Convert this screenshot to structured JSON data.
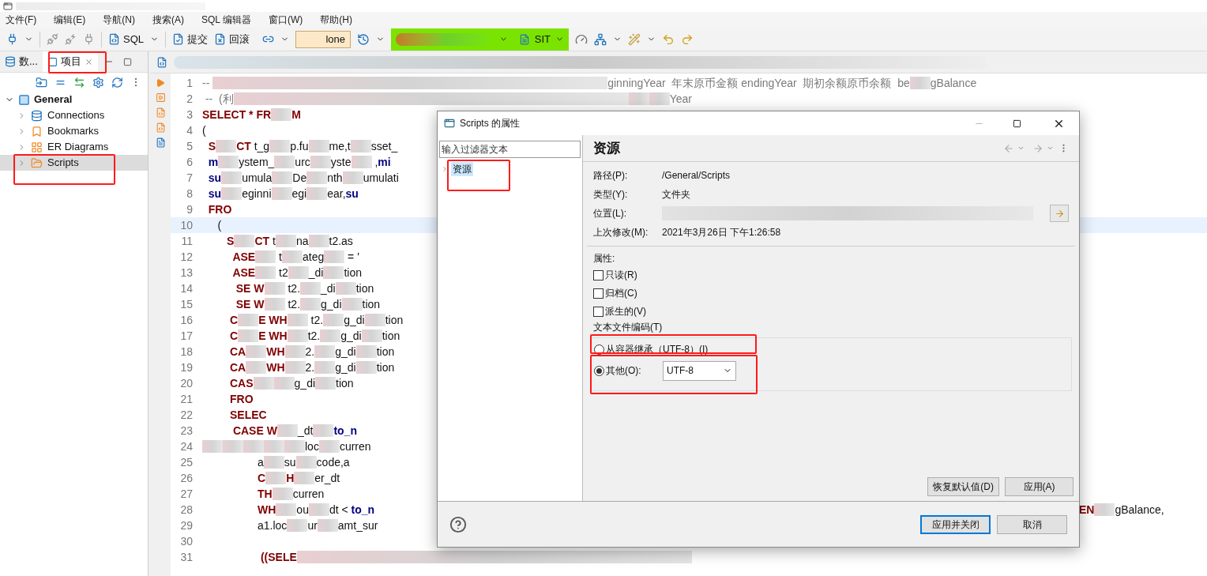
{
  "menu": [
    {
      "label": "文件(F)"
    },
    {
      "label": "编辑(E)"
    },
    {
      "label": "导航(N)"
    },
    {
      "label": "搜索(A)"
    },
    {
      "label": "SQL 编辑器"
    },
    {
      "label": "窗口(W)"
    },
    {
      "label": "帮助(H)"
    }
  ],
  "toolbar": {
    "sql": "SQL",
    "commit": "提交",
    "rollback": "回滚",
    "transaction": "lone",
    "environment": "SIT"
  },
  "left_panel": {
    "tabs": [
      {
        "label": "数...",
        "selected": false
      },
      {
        "label": "项目",
        "selected": true
      }
    ],
    "tree": {
      "label": "General",
      "expanded": true,
      "children": [
        {
          "label": "Connections",
          "kind": "connections",
          "expanded": false,
          "selected": false
        },
        {
          "label": "Bookmarks",
          "kind": "bookmarks",
          "expanded": false,
          "selected": false
        },
        {
          "label": "ER Diagrams",
          "kind": "diagrams",
          "expanded": false,
          "selected": false
        },
        {
          "label": "Scripts",
          "kind": "scripts",
          "expanded": false,
          "selected": true
        }
      ]
    }
  },
  "editor": {
    "lines": [
      {
        "number": "1",
        "current": false,
        "segments": [
          {
            "kind": "comment",
            "text": "-- "
          },
          {
            "kind": "wide_blur"
          },
          {
            "kind": "comment",
            "text": "ginningYear  年末原币金额 endingYear  期初余额原币余额  be"
          },
          {
            "kind": "blur"
          },
          {
            "kind": "comment",
            "text": "gBalance"
          }
        ]
      },
      {
        "number": "2",
        "current": false,
        "segments": [
          {
            "kind": "comment",
            "text": " --  (利"
          },
          {
            "kind": "wide_blur"
          },
          {
            "kind": "blur"
          },
          {
            "kind": "blur"
          },
          {
            "kind": "comment",
            "text": "Year"
          }
        ]
      },
      {
        "number": "3",
        "current": false,
        "segments": [
          {
            "kind": "kw",
            "text": "SELECT * FR"
          },
          {
            "kind": "blur"
          },
          {
            "kind": "kw",
            "text": "M"
          }
        ]
      },
      {
        "number": "4",
        "current": false,
        "segments": [
          {
            "kind": "plain",
            "text": "("
          }
        ]
      },
      {
        "number": "5",
        "current": false,
        "segments": [
          {
            "kind": "kw",
            "text": "  S"
          },
          {
            "kind": "blur"
          },
          {
            "kind": "kw",
            "text": "CT"
          },
          {
            "kind": "plain",
            "text": " t_g"
          },
          {
            "kind": "blur"
          },
          {
            "kind": "plain",
            "text": "p.fu"
          },
          {
            "kind": "blur"
          },
          {
            "kind": "plain",
            "text": "me,t"
          },
          {
            "kind": "blur"
          },
          {
            "kind": "plain",
            "text": "sset_"
          }
        ]
      },
      {
        "number": "6",
        "current": false,
        "segments": [
          {
            "kind": "fn",
            "text": "  m"
          },
          {
            "kind": "blur"
          },
          {
            "kind": "plain",
            "text": "ystem_"
          },
          {
            "kind": "blur"
          },
          {
            "kind": "plain",
            "text": "urc"
          },
          {
            "kind": "blur"
          },
          {
            "kind": "plain",
            "text": "yste"
          },
          {
            "kind": "blur"
          },
          {
            "kind": "plain",
            "text": " ,"
          },
          {
            "kind": "fn",
            "text": "mi"
          }
        ]
      },
      {
        "number": "7",
        "current": false,
        "segments": [
          {
            "kind": "fn",
            "text": "  su"
          },
          {
            "kind": "blur"
          },
          {
            "kind": "plain",
            "text": "umula"
          },
          {
            "kind": "blur"
          },
          {
            "kind": "plain",
            "text": "De"
          },
          {
            "kind": "blur"
          },
          {
            "kind": "plain",
            "text": "nth"
          },
          {
            "kind": "blur"
          },
          {
            "kind": "plain",
            "text": "umulati"
          }
        ]
      },
      {
        "number": "8",
        "current": false,
        "segments": [
          {
            "kind": "fn",
            "text": "  su"
          },
          {
            "kind": "blur"
          },
          {
            "kind": "plain",
            "text": "eginni"
          },
          {
            "kind": "blur"
          },
          {
            "kind": "plain",
            "text": "egi"
          },
          {
            "kind": "blur"
          },
          {
            "kind": "plain",
            "text": "ear,"
          },
          {
            "kind": "fn",
            "text": "su"
          }
        ]
      },
      {
        "number": "9",
        "current": false,
        "segments": [
          {
            "kind": "kw",
            "text": "  FRO"
          }
        ]
      },
      {
        "number": "10",
        "current": true,
        "segments": [
          {
            "kind": "plain",
            "text": "     ("
          }
        ]
      },
      {
        "number": "11",
        "current": false,
        "segments": [
          {
            "kind": "kw",
            "text": "        S"
          },
          {
            "kind": "blur"
          },
          {
            "kind": "kw",
            "text": "CT"
          },
          {
            "kind": "plain",
            "text": " t"
          },
          {
            "kind": "blur"
          },
          {
            "kind": "plain",
            "text": "na"
          },
          {
            "kind": "blur"
          },
          {
            "kind": "plain",
            "text": "t2.as"
          }
        ]
      },
      {
        "number": "12",
        "current": false,
        "segments": [
          {
            "kind": "kw",
            "text": "          ASE"
          },
          {
            "kind": "blur"
          },
          {
            "kind": "plain",
            "text": " t"
          },
          {
            "kind": "blur"
          },
          {
            "kind": "plain",
            "text": "ateg"
          },
          {
            "kind": "blur"
          },
          {
            "kind": "plain",
            "text": " = '"
          }
        ]
      },
      {
        "number": "13",
        "current": false,
        "segments": [
          {
            "kind": "kw",
            "text": "          ASE"
          },
          {
            "kind": "blur"
          },
          {
            "kind": "plain",
            "text": " t2"
          },
          {
            "kind": "blur"
          },
          {
            "kind": "plain",
            "text": "_di"
          },
          {
            "kind": "blur"
          },
          {
            "kind": "plain",
            "text": "tion"
          }
        ]
      },
      {
        "number": "14",
        "current": false,
        "segments": [
          {
            "kind": "kw",
            "text": "           SE W"
          },
          {
            "kind": "blur"
          },
          {
            "kind": "plain",
            "text": " t2."
          },
          {
            "kind": "blur"
          },
          {
            "kind": "plain",
            "text": "_di"
          },
          {
            "kind": "blur"
          },
          {
            "kind": "plain",
            "text": "tion"
          }
        ]
      },
      {
        "number": "15",
        "current": false,
        "segments": [
          {
            "kind": "kw",
            "text": "           SE W"
          },
          {
            "kind": "blur"
          },
          {
            "kind": "plain",
            "text": " t2."
          },
          {
            "kind": "blur"
          },
          {
            "kind": "plain",
            "text": "g_di"
          },
          {
            "kind": "blur"
          },
          {
            "kind": "plain",
            "text": "tion"
          }
        ]
      },
      {
        "number": "16",
        "current": false,
        "segments": [
          {
            "kind": "kw",
            "text": "         C"
          },
          {
            "kind": "blur"
          },
          {
            "kind": "kw",
            "text": "E WH"
          },
          {
            "kind": "blur"
          },
          {
            "kind": "plain",
            "text": " t2."
          },
          {
            "kind": "blur"
          },
          {
            "kind": "plain",
            "text": "g_di"
          },
          {
            "kind": "blur"
          },
          {
            "kind": "plain",
            "text": "tion"
          }
        ]
      },
      {
        "number": "17",
        "current": false,
        "segments": [
          {
            "kind": "kw",
            "text": "         C"
          },
          {
            "kind": "blur"
          },
          {
            "kind": "kw",
            "text": "E WH"
          },
          {
            "kind": "blur"
          },
          {
            "kind": "plain",
            "text": "t2."
          },
          {
            "kind": "blur"
          },
          {
            "kind": "plain",
            "text": "g_di"
          },
          {
            "kind": "blur"
          },
          {
            "kind": "plain",
            "text": "tion"
          }
        ]
      },
      {
        "number": "18",
        "current": false,
        "segments": [
          {
            "kind": "kw",
            "text": "         CA"
          },
          {
            "kind": "blur"
          },
          {
            "kind": "kw",
            "text": "WH"
          },
          {
            "kind": "blur"
          },
          {
            "kind": "plain",
            "text": "2."
          },
          {
            "kind": "blur"
          },
          {
            "kind": "plain",
            "text": "g_di"
          },
          {
            "kind": "blur"
          },
          {
            "kind": "plain",
            "text": "tion"
          }
        ]
      },
      {
        "number": "19",
        "current": false,
        "segments": [
          {
            "kind": "kw",
            "text": "         CA"
          },
          {
            "kind": "blur"
          },
          {
            "kind": "kw",
            "text": "WH"
          },
          {
            "kind": "blur"
          },
          {
            "kind": "plain",
            "text": "2."
          },
          {
            "kind": "blur"
          },
          {
            "kind": "plain",
            "text": "g_di"
          },
          {
            "kind": "blur"
          },
          {
            "kind": "plain",
            "text": "tion"
          }
        ]
      },
      {
        "number": "20",
        "current": false,
        "segments": [
          {
            "kind": "kw",
            "text": "         CAS"
          },
          {
            "kind": "blur"
          },
          {
            "kind": "blur"
          },
          {
            "kind": "plain",
            "text": "g_di"
          },
          {
            "kind": "blur"
          },
          {
            "kind": "plain",
            "text": "tion"
          }
        ]
      },
      {
        "number": "21",
        "current": false,
        "segments": [
          {
            "kind": "kw",
            "text": "         FRO"
          }
        ]
      },
      {
        "number": "22",
        "current": false,
        "segments": [
          {
            "kind": "kw",
            "text": "         SELEC"
          }
        ]
      },
      {
        "number": "23",
        "current": false,
        "segments": [
          {
            "kind": "kw",
            "text": "          CASE W"
          },
          {
            "kind": "blur"
          },
          {
            "kind": "plain",
            "text": "_dt"
          },
          {
            "kind": "blur"
          },
          {
            "kind": "fn",
            "text": "to_n"
          }
        ]
      },
      {
        "number": "24",
        "current": false,
        "segments": [
          {
            "kind": "blur"
          },
          {
            "kind": "blur"
          },
          {
            "kind": "blur"
          },
          {
            "kind": "blur"
          },
          {
            "kind": "blur"
          },
          {
            "kind": "plain",
            "text": "loc"
          },
          {
            "kind": "blur"
          },
          {
            "kind": "plain",
            "text": "curren"
          }
        ]
      },
      {
        "number": "25",
        "current": false,
        "segments": [
          {
            "kind": "plain",
            "text": "                  a"
          },
          {
            "kind": "blur"
          },
          {
            "kind": "plain",
            "text": "su"
          },
          {
            "kind": "blur"
          },
          {
            "kind": "plain",
            "text": "code,a"
          }
        ]
      },
      {
        "number": "26",
        "current": false,
        "segments": [
          {
            "kind": "kw",
            "text": "                  C"
          },
          {
            "kind": "blur"
          },
          {
            "kind": "kw",
            "text": "H"
          },
          {
            "kind": "blur"
          },
          {
            "kind": "plain",
            "text": "er_dt"
          }
        ]
      },
      {
        "number": "27",
        "current": false,
        "segments": [
          {
            "kind": "kw",
            "text": "                  TH"
          },
          {
            "kind": "blur"
          },
          {
            "kind": "plain",
            "text": "curren"
          }
        ]
      },
      {
        "number": "28",
        "current": false,
        "segments": [
          {
            "kind": "kw",
            "text": "                  WH"
          },
          {
            "kind": "blur"
          },
          {
            "kind": "plain",
            "text": "ou"
          },
          {
            "kind": "blur"
          },
          {
            "kind": "plain",
            "text": "dt < "
          },
          {
            "kind": "fn",
            "text": "to_n"
          }
        ],
        "tail": [
          {
            "kind": "kw",
            "text": "EN"
          },
          {
            "kind": "blur"
          },
          {
            "kind": "plain",
            "text": "gBalance,"
          }
        ]
      },
      {
        "number": "29",
        "current": false,
        "segments": [
          {
            "kind": "plain",
            "text": "                  a1.loc"
          },
          {
            "kind": "blur"
          },
          {
            "kind": "plain",
            "text": "ur"
          },
          {
            "kind": "blur"
          },
          {
            "kind": "plain",
            "text": "amt_sur"
          }
        ]
      },
      {
        "number": "30",
        "current": false
      },
      {
        "number": "31",
        "current": false,
        "segments": [
          {
            "kind": "kw",
            "text": "                   ((SELE"
          },
          {
            "kind": "wide_blur"
          }
        ]
      }
    ]
  },
  "dialog": {
    "title": "Scripts 的属性",
    "filter": {
      "placeholder": "输入过滤器文本"
    },
    "pages": [
      {
        "label": "资源",
        "selected": true
      }
    ],
    "heading": "资源",
    "fields": [
      {
        "label": "路径(P):",
        "value": "/General/Scripts"
      },
      {
        "label": "类型(Y):",
        "value": "文件夹"
      },
      {
        "label": "位置(L):",
        "kind": "blurred"
      },
      {
        "label": "上次修改(M):",
        "value": "2021年3月26日 下午1:26:58"
      }
    ],
    "attributes_label": "属性:",
    "attributes": [
      {
        "label": "只读(R)",
        "checked": false
      },
      {
        "label": "归档(C)",
        "checked": false
      },
      {
        "label": "派生的(V)",
        "checked": false
      }
    ],
    "encoding": {
      "label": "文本文件编码(T)",
      "options": [
        {
          "label": "从容器继承（UTF-8）(I)",
          "selected": false
        },
        {
          "label": "其他(O):",
          "selected": true,
          "value": "UTF-8"
        }
      ]
    },
    "page_buttons": [
      "恢复默认值(D)",
      "应用(A)"
    ],
    "apply_close": "应用并关闭",
    "cancel": "取消"
  }
}
